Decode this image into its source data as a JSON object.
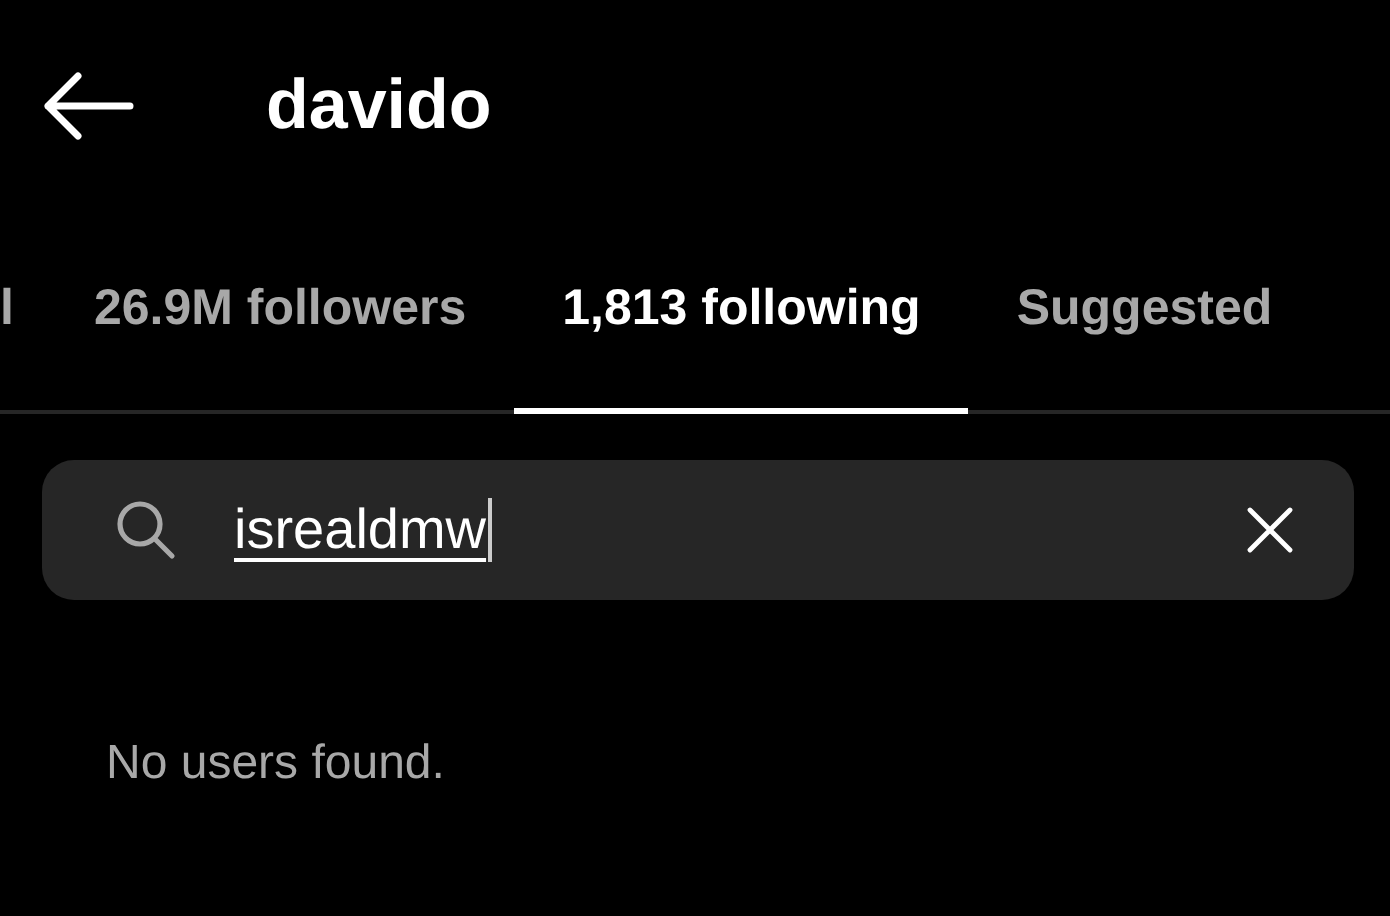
{
  "header": {
    "title": "davido"
  },
  "tabs": [
    {
      "label": "l",
      "selected": false
    },
    {
      "label": "26.9M followers",
      "selected": false
    },
    {
      "label": "1,813 following",
      "selected": true
    },
    {
      "label": "Suggested",
      "selected": false
    }
  ],
  "search": {
    "value": "isrealdmw"
  },
  "empty_message": "No users found."
}
